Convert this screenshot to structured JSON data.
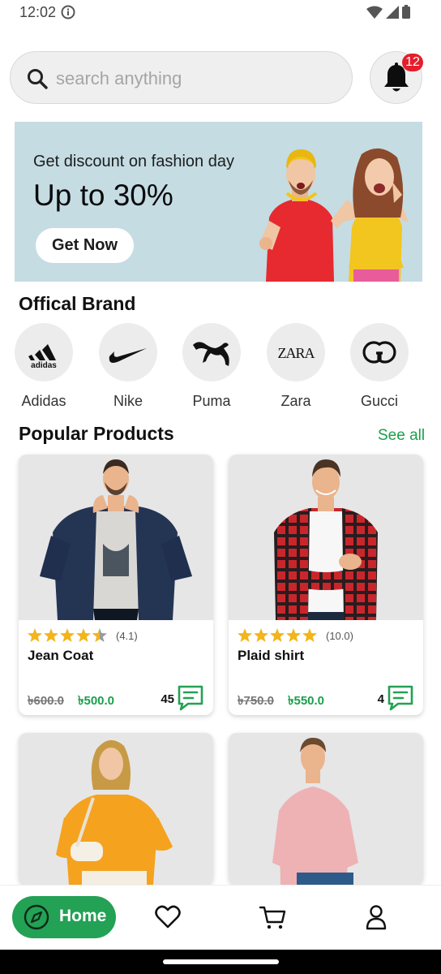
{
  "status": {
    "time": "12:02"
  },
  "search": {
    "placeholder": "search anything"
  },
  "notifications": {
    "count": "12"
  },
  "banner": {
    "subtitle": "Get discount on fashion day",
    "title": "Up to 30%",
    "button": "Get Now"
  },
  "brands": {
    "title": "Offical Brand",
    "items": [
      {
        "label": "Adidas",
        "icon": "adidas-logo"
      },
      {
        "label": "Nike",
        "icon": "nike-logo"
      },
      {
        "label": "Puma",
        "icon": "puma-logo"
      },
      {
        "label": "Zara",
        "icon": "zara-logo"
      },
      {
        "label": "Gucci",
        "icon": "gucci-logo"
      }
    ]
  },
  "popular": {
    "title": "Popular Products",
    "see_all": "See all",
    "products": [
      {
        "name": "Jean Coat",
        "rating": 4.1,
        "rating_text": "(4.1)",
        "old_price": "৳600.0",
        "new_price": "৳500.0",
        "reviews": "45"
      },
      {
        "name": "Plaid shirt",
        "rating": 5,
        "rating_text": "(10.0)",
        "old_price": "৳750.0",
        "new_price": "৳550.0",
        "reviews": "4"
      },
      {
        "name": "",
        "image": "yellow-sweater"
      },
      {
        "name": "",
        "image": "pink-sweater"
      }
    ]
  },
  "nav": {
    "home": "Home",
    "items": [
      "home-icon",
      "heart-icon",
      "cart-icon",
      "profile-icon"
    ]
  },
  "colors": {
    "accent": "#23a155",
    "price_green": "#19a04b",
    "badge_red": "#e41e2b",
    "banner_bg": "#c5dce3",
    "star": "#f2b51c"
  }
}
